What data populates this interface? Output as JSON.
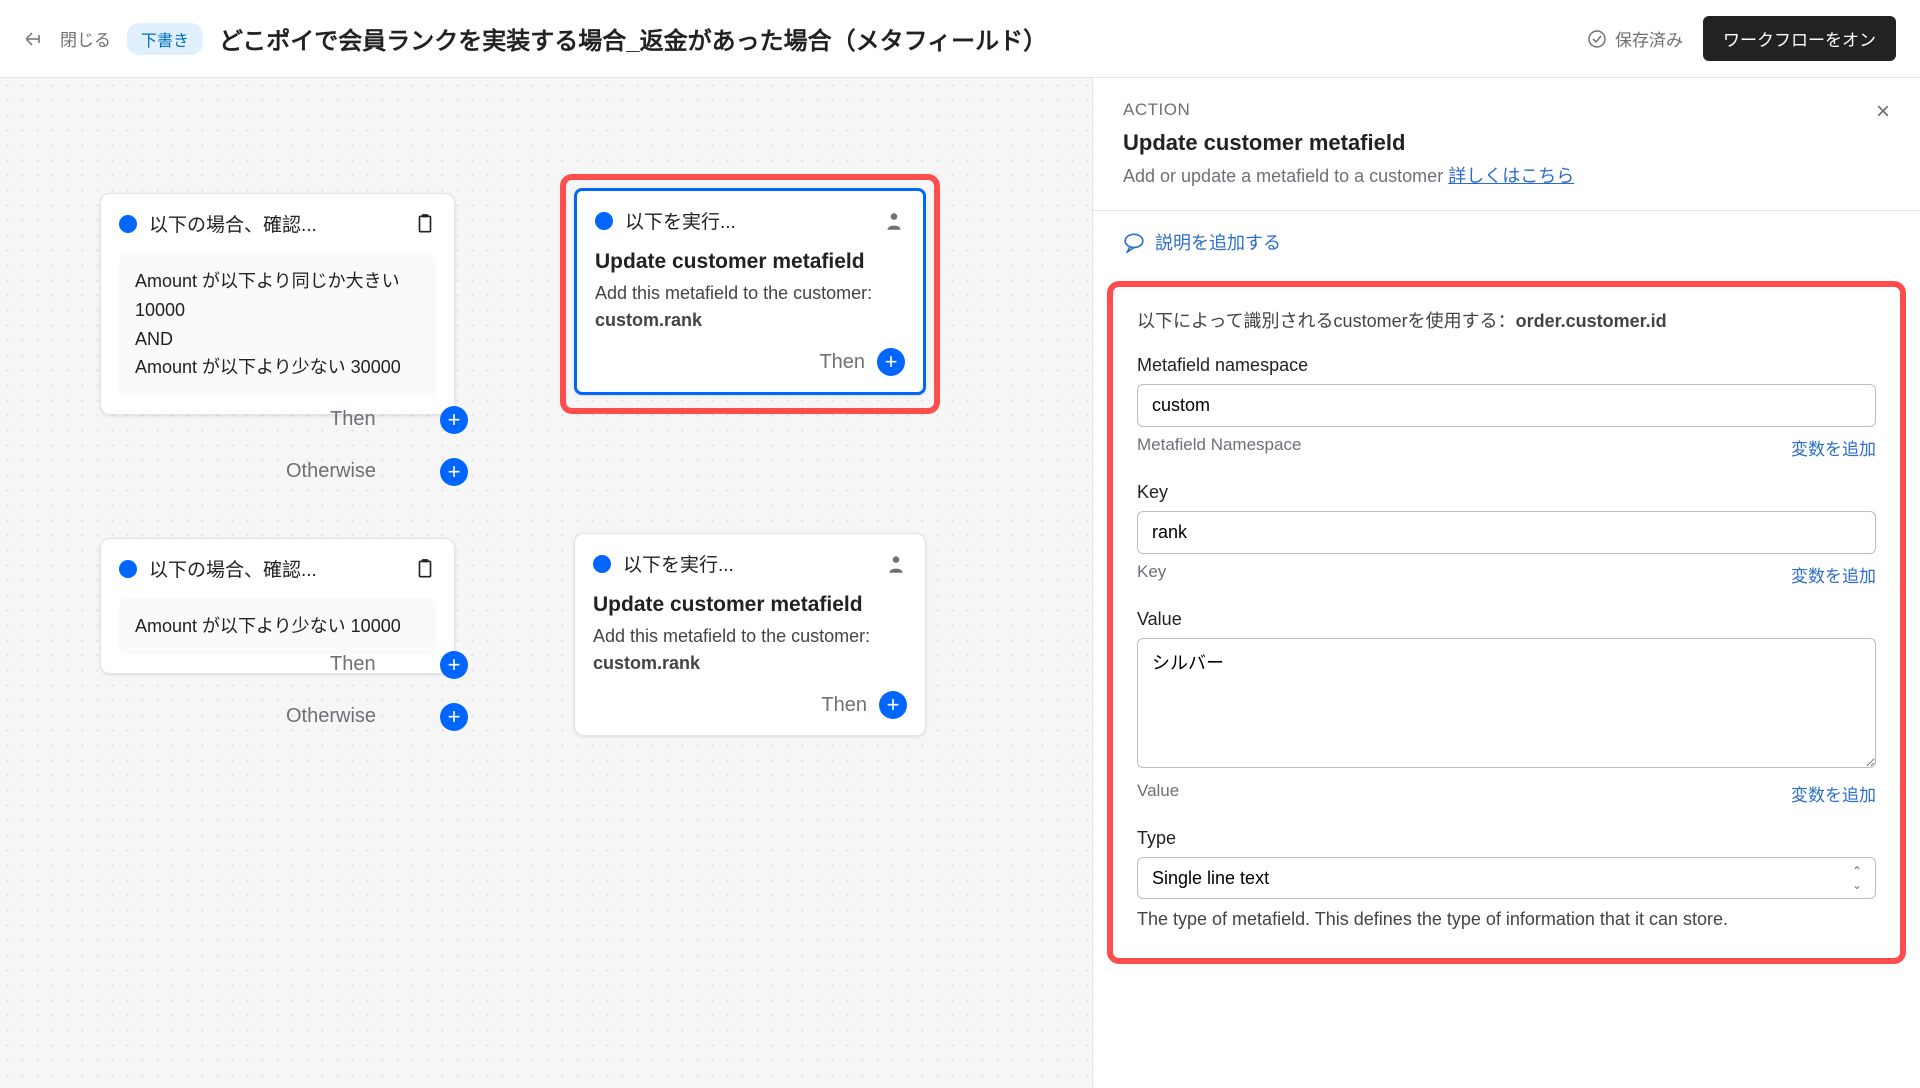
{
  "header": {
    "close": "閉じる",
    "draft_badge": "下書き",
    "title": "どこポイで会員ランクを実装する場合_返金があった場合（メタフィールド）",
    "saved": "保存済み",
    "primary_btn": "ワークフローをオン"
  },
  "canvas": {
    "condition1": {
      "title": "以下の場合、確認...",
      "line1": "Amount が以下より同じか大きい 10000",
      "and": "AND",
      "line2": "Amount が以下より少ない 30000",
      "then": "Then",
      "otherwise": "Otherwise"
    },
    "condition2": {
      "title": "以下の場合、確認...",
      "line1": "Amount が以下より少ない 10000",
      "then": "Then",
      "otherwise": "Otherwise"
    },
    "action1": {
      "title": "以下を実行...",
      "at": "Update customer metafield",
      "sub": "Add this metafield to the customer:",
      "ns": "custom.rank",
      "then": "Then"
    },
    "action2": {
      "title": "以下を実行...",
      "at": "Update customer metafield",
      "sub": "Add this metafield to the customer:",
      "ns": "custom.rank",
      "then": "Then"
    }
  },
  "panel": {
    "section_label": "ACTION",
    "title": "Update customer metafield",
    "subtitle": "Add or update a metafield to a customer",
    "details_link": "詳しくはこちら",
    "add_description": "説明を追加する",
    "form": {
      "identifier_text_before": "以下によって識別されるcustomerを使用する：",
      "identifier_value": "order.customer.id",
      "namespace_label": "Metafield namespace",
      "namespace_value": "custom",
      "namespace_help": "Metafield Namespace",
      "add_variable": "変数を追加",
      "key_label": "Key",
      "key_value": "rank",
      "key_help": "Key",
      "value_label": "Value",
      "value_value": "シルバー",
      "value_help": "Value",
      "type_label": "Type",
      "type_value": "Single line text",
      "type_help": "The type of metafield. This defines the type of information that it can store."
    }
  }
}
